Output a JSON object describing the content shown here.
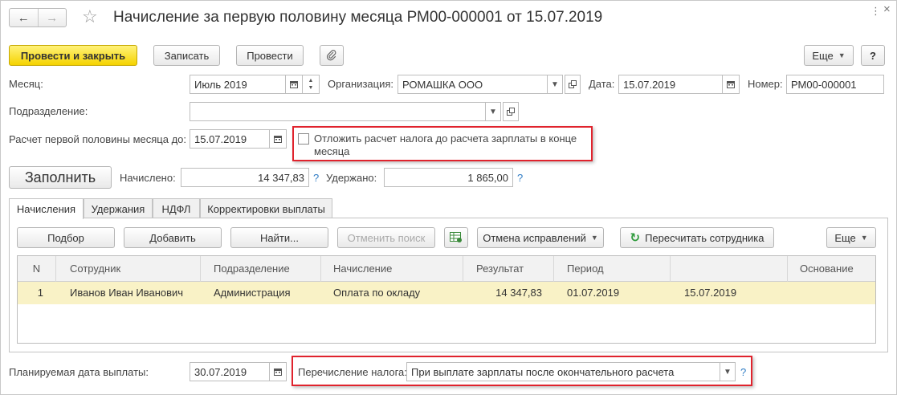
{
  "header": {
    "back_icon": "←",
    "forward_icon": "→",
    "favorite_icon": "☆",
    "title": "Начисление за первую половину месяца РМ00-000001 от 15.07.2019",
    "menu_icon": "⋮",
    "close_icon": "×"
  },
  "toolbar": {
    "post_close": "Провести и закрыть",
    "save": "Записать",
    "post": "Провести",
    "attach_icon": "paperclip",
    "more": "Еще",
    "help": "?"
  },
  "form": {
    "month_label": "Месяц:",
    "month_value": "Июль 2019",
    "org_label": "Организация:",
    "org_value": "РОМАШКА ООО",
    "date_label": "Дата:",
    "date_value": "15.07.2019",
    "number_label": "Номер:",
    "number_value": "РМ00-000001",
    "division_label": "Подразделение:",
    "division_value": "",
    "calc_until_label": "Расчет первой половины месяца до:",
    "calc_until_value": "15.07.2019",
    "postpone_tax_label_line1": "Отложить расчет налога до расчета зарплаты в конце",
    "postpone_tax_label_line2": "месяца",
    "postpone_tax_checked": false,
    "fill_button": "Заполнить",
    "accrued_label": "Начислено:",
    "accrued_value": "14 347,83",
    "withheld_label": "Удержано:",
    "withheld_value": "1 865,00",
    "help_mark": "?"
  },
  "tabs": [
    {
      "label": "Начисления",
      "active": true
    },
    {
      "label": "Удержания",
      "active": false
    },
    {
      "label": "НДФЛ",
      "active": false
    },
    {
      "label": "Корректировки выплаты",
      "active": false
    }
  ],
  "table_toolbar": {
    "pick": "Подбор",
    "add": "Добавить",
    "find": "Найти...",
    "cancel_search": "Отменить поиск",
    "fixes": "Отмена исправлений",
    "recalc": "Пересчитать сотрудника",
    "more": "Еще"
  },
  "table": {
    "columns": [
      "N",
      "Сотрудник",
      "Подразделение",
      "Начисление",
      "Результат",
      "Период",
      "",
      "Основание"
    ],
    "rows": [
      [
        "1",
        "Иванов Иван Иванович",
        "Администрация",
        "Оплата по окладу",
        "14 347,83",
        "01.07.2019",
        "15.07.2019",
        ""
      ]
    ]
  },
  "footer": {
    "pay_date_label": "Планируемая дата выплаты:",
    "pay_date_value": "30.07.2019",
    "tax_transfer_label": "Перечисление налога:",
    "tax_transfer_value": "При выплате зарплаты после окончательного расчета",
    "help_mark": "?"
  },
  "colors": {
    "primary_button": "#f5d300",
    "highlight_border": "#e0232d",
    "selected_row": "#f9f2c6",
    "help_link": "#2f7cc5"
  }
}
